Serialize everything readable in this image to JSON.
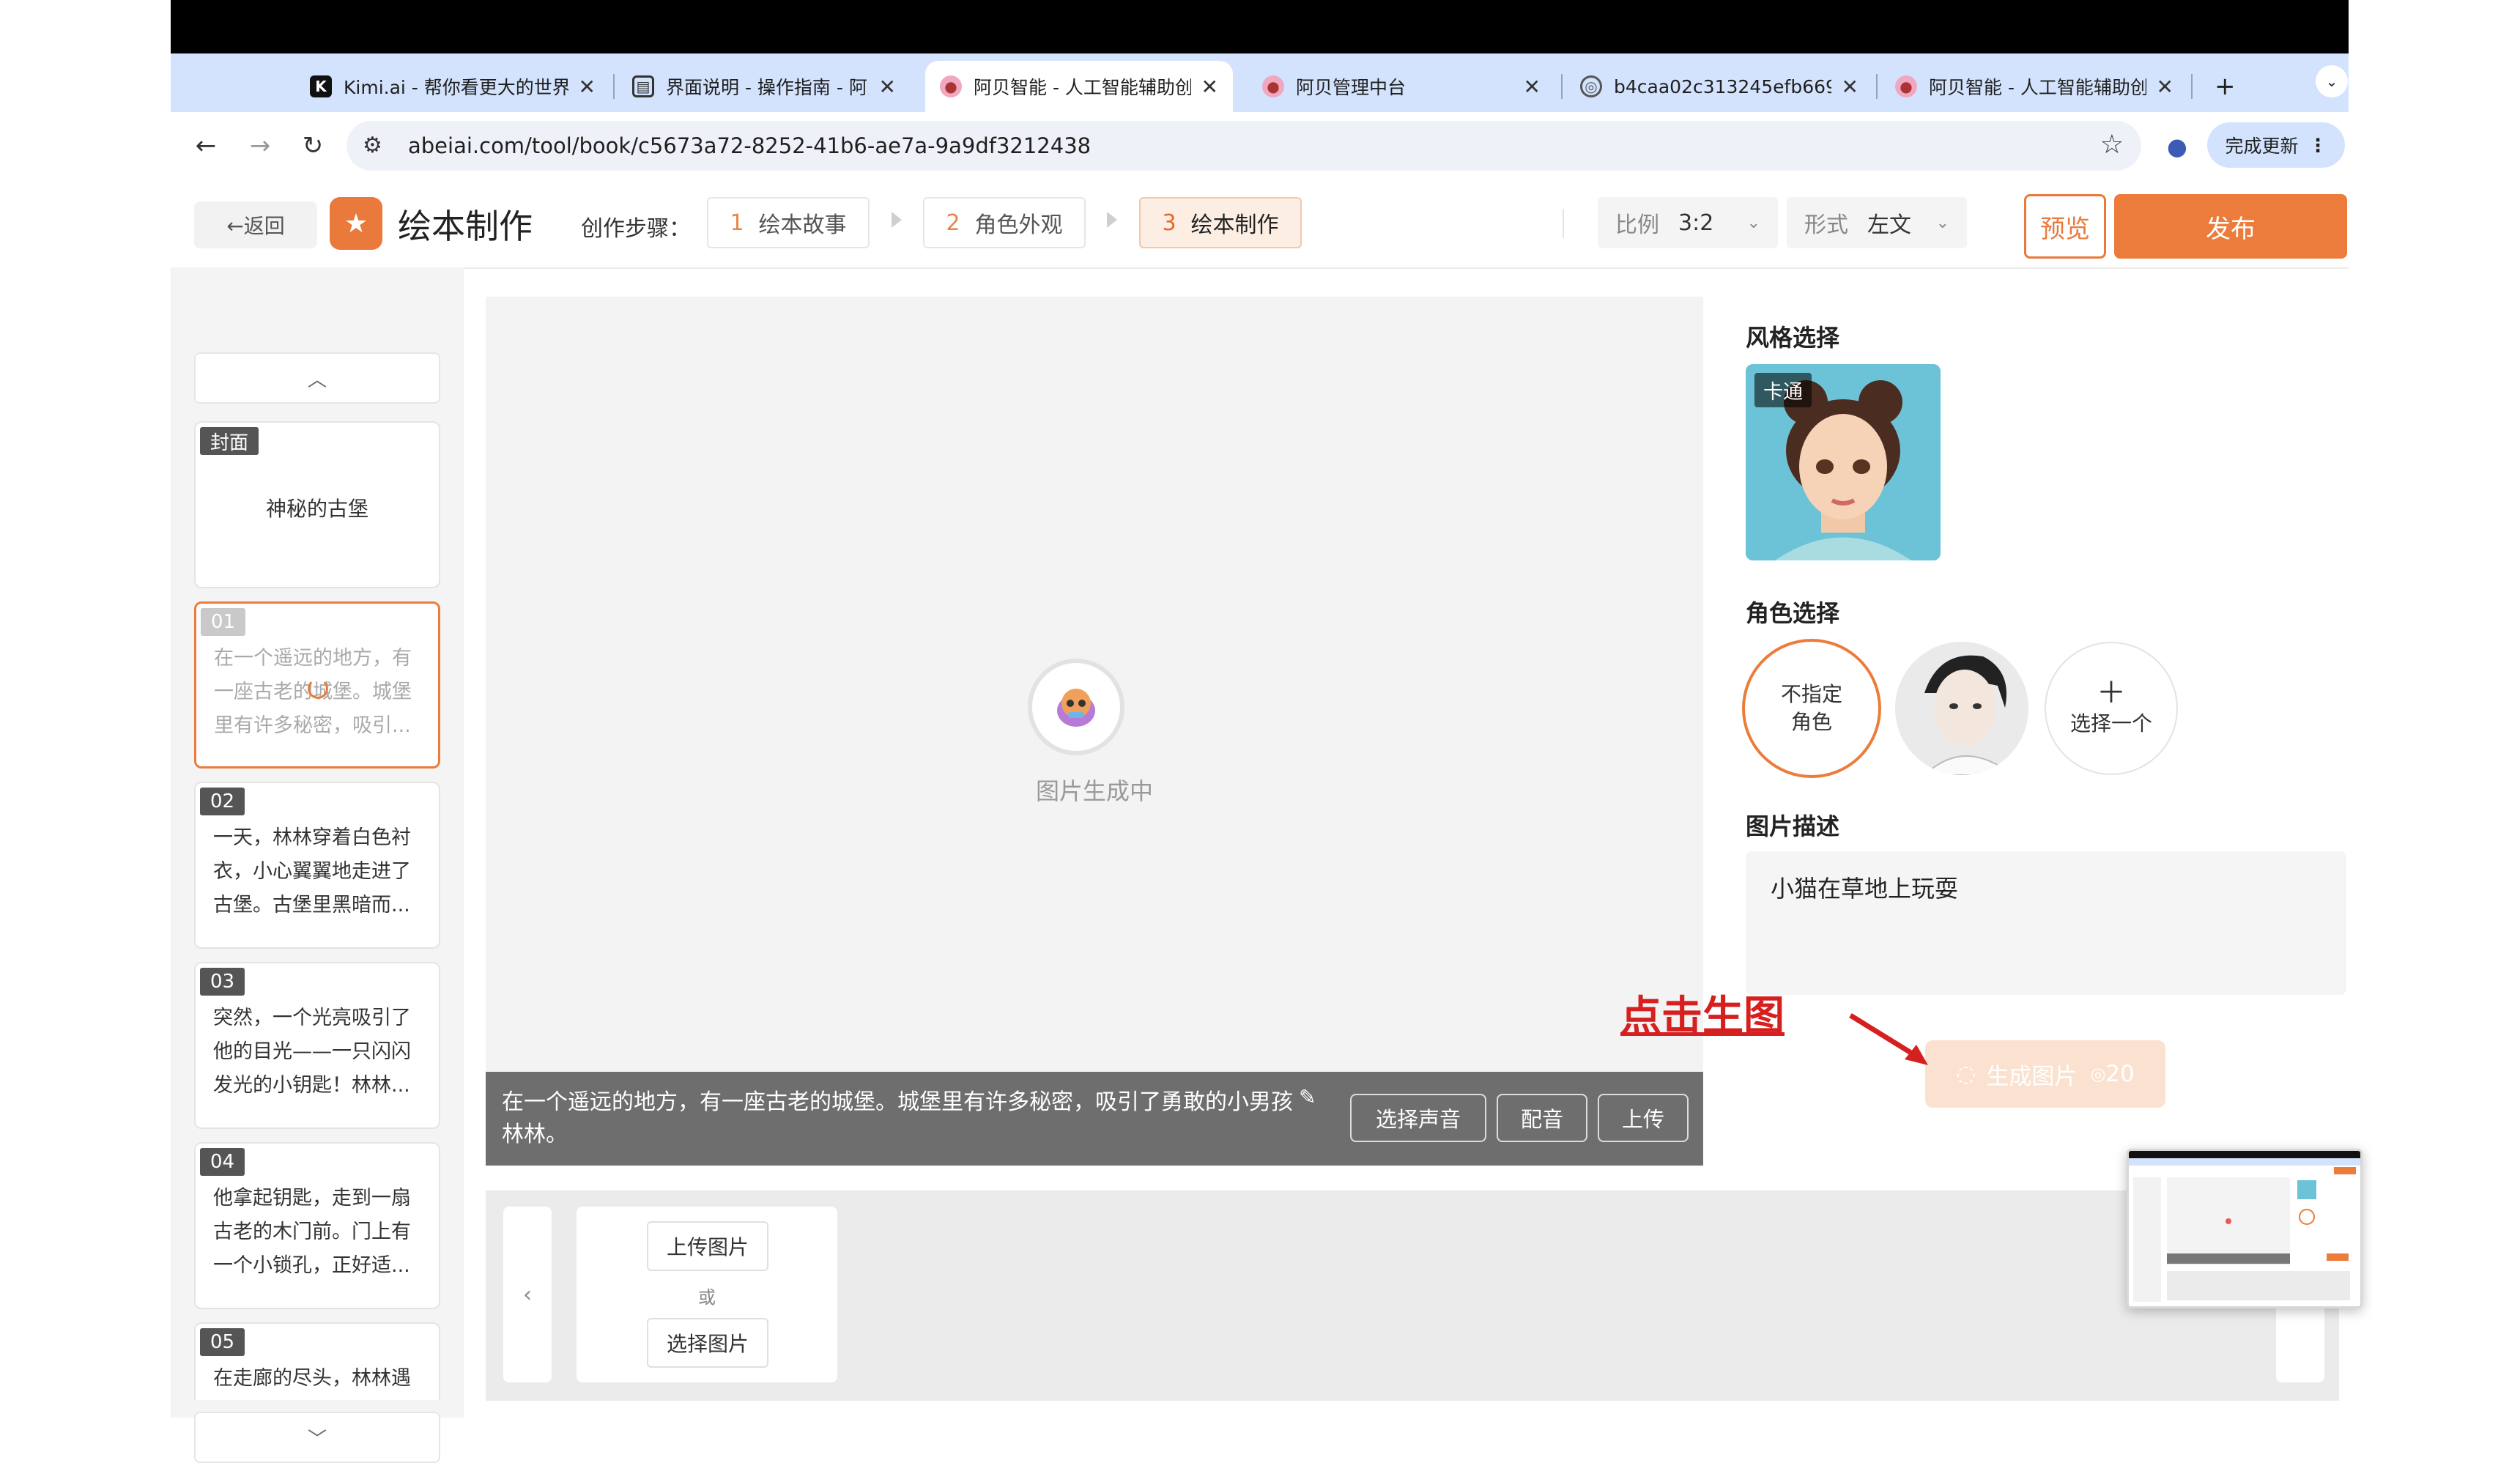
{
  "browser": {
    "tabs": [
      {
        "title": "Kimi.ai - 帮你看更大的世界",
        "icon": "kimi-favicon",
        "active": false
      },
      {
        "title": "界面说明 - 操作指南 - 阿贝",
        "icon": "doc-favicon",
        "active": false
      },
      {
        "title": "阿贝智能 - 人工智能辅助创",
        "icon": "abei-favicon",
        "active": true
      },
      {
        "title": "阿贝管理中台",
        "icon": "abei-favicon",
        "active": false
      },
      {
        "title": "b4caa02c313245efb669",
        "icon": "globe-favicon",
        "active": false
      },
      {
        "title": "阿贝智能 - 人工智能辅助创",
        "icon": "abei-favicon",
        "active": false
      }
    ],
    "new_tab_symbol": "+",
    "url": "abeiai.com/tool/book/c5673a72-8252-41b6-ae7a-9a9df3212438",
    "update_button": "完成更新"
  },
  "header": {
    "back_label": "←返回",
    "title": "绘本制作",
    "steps_label": "创作步骤：",
    "steps": [
      {
        "num": "1",
        "label": "绘本故事"
      },
      {
        "num": "2",
        "label": "角色外观"
      },
      {
        "num": "3",
        "label": "绘本制作"
      }
    ],
    "ratio_label": "比例",
    "ratio_value": "3:2",
    "format_label": "形式",
    "format_value": "左文",
    "preview_label": "预览",
    "publish_label": "发布"
  },
  "sidebar": {
    "cover_badge": "封面",
    "cover_title": "神秘的古堡",
    "pages": [
      {
        "num": "01",
        "text": "在一个遥远的地方，有一座古老的城堡。城堡里有许多秘密，吸引..."
      },
      {
        "num": "02",
        "text": "一天，林林穿着白色衬衣，小心翼翼地走进了古堡。古堡里黑暗而..."
      },
      {
        "num": "03",
        "text": "突然，一个光亮吸引了他的目光——一只闪闪发光的小钥匙！林林..."
      },
      {
        "num": "04",
        "text": "他拿起钥匙，走到一扇古老的木门前。门上有一个小锁孔，正好适..."
      },
      {
        "num": "05",
        "text": "在走廊的尽头，林林遇"
      }
    ]
  },
  "canvas": {
    "loading_text": "图片生成中",
    "caption": "在一个遥远的地方，有一座古老的城堡。城堡里有许多秘密，吸引了勇敢的小男孩林林。",
    "caption_buttons": [
      "选择声音",
      "配音",
      "上传"
    ]
  },
  "strip": {
    "upload_label": "上传图片",
    "or_label": "或",
    "select_label": "选择图片"
  },
  "panel": {
    "style_title": "风格选择",
    "style_tag": "卡通",
    "role_title": "角色选择",
    "role_none_line1": "不指定",
    "role_none_line2": "角色",
    "role_add": "选择一个",
    "desc_title": "图片描述",
    "desc_text": "小猫在草地上玩耍",
    "generate_label": "生成图片",
    "generate_cost": "20"
  },
  "annotation": {
    "text": "点击生图"
  },
  "colors": {
    "accent": "#ec7c3c",
    "annotation_red": "#d62020",
    "tabstrip": "#d3e3fd"
  }
}
